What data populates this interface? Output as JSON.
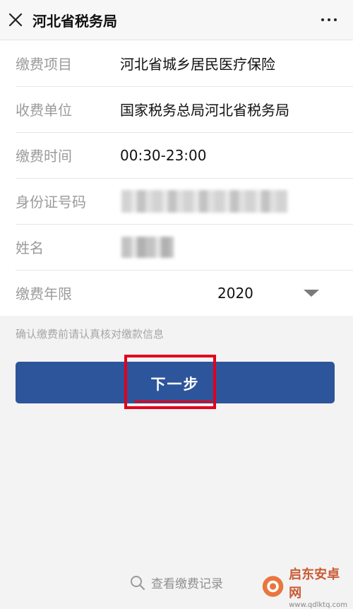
{
  "header": {
    "title": "河北省税务局"
  },
  "form": {
    "rows": [
      {
        "label": "缴费项目",
        "value": "河北省城乡居民医疗保险"
      },
      {
        "label": "收费单位",
        "value": "国家税务总局河北省税务局"
      },
      {
        "label": "缴费时间",
        "value": "00:30-23:00"
      },
      {
        "label": "身份证号码",
        "value": ""
      },
      {
        "label": "姓名",
        "value": ""
      },
      {
        "label": "缴费年限",
        "value": "2020"
      }
    ]
  },
  "hint": "确认缴费前请认真核对缴款信息",
  "primary_button": {
    "label": "下一步"
  },
  "footer": {
    "records_label": "查看缴费记录"
  },
  "watermark": {
    "title": "启东安卓网",
    "url": "www.qdlktq.com"
  },
  "colors": {
    "accent": "#2d559b",
    "highlight": "#e3001b",
    "page_bg": "#f3f3f3"
  }
}
